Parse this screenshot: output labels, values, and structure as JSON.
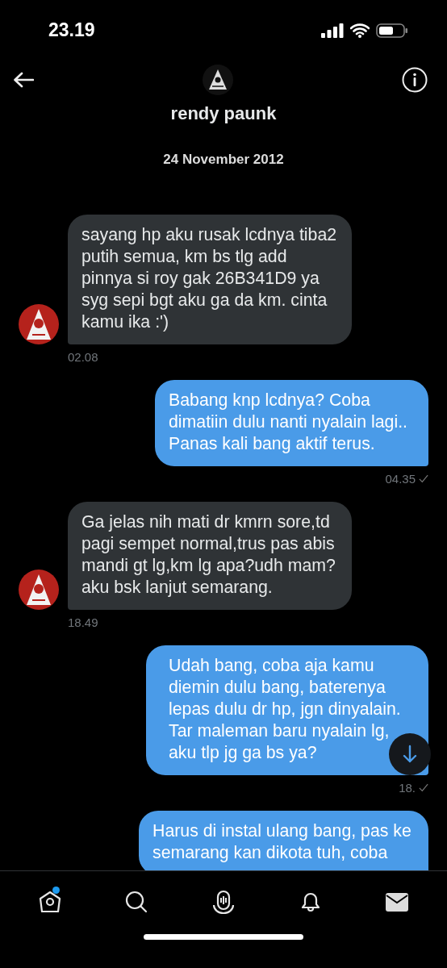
{
  "status_bar": {
    "time": "23.19"
  },
  "header": {
    "name": "rendy paunk",
    "date": "24 November 2012"
  },
  "messages": [
    {
      "kind": "received",
      "text": "sayang hp aku rusak lcdnya tiba2 putih semua, km bs tlg add pinnya si roy gak 26B341D9 ya syg sepi bgt aku ga da km. cinta kamu ika  :')",
      "time": "02.08"
    },
    {
      "kind": "sent",
      "text": "Babang knp lcdnya? Coba dimatiin dulu nanti nyalain lagi.. Panas kali bang aktif terus.",
      "time": "04.35",
      "checked": true
    },
    {
      "kind": "received",
      "text": "Ga jelas nih mati dr kmrn sore,td pagi sempet normal,trus pas abis mandi gt lg,km lg apa?udh mam? aku bsk lanjut semarang.",
      "time": "18.49"
    },
    {
      "kind": "sent",
      "text": "Udah bang, coba aja kamu diemin dulu bang, baterenya lepas dulu dr hp, jgn dinyalain. Tar maleman baru nyalain lg, aku tlp jg ga bs ya?",
      "time": "18.",
      "checked": true
    },
    {
      "kind": "sent",
      "text": "Harus di instal ulang bang, pas ke semarang kan dikota tuh, coba"
    }
  ],
  "nav": [
    {
      "kind": "home",
      "selected": false,
      "badge": true
    },
    {
      "kind": "search",
      "selected": false,
      "badge": false
    },
    {
      "kind": "spaces",
      "selected": false,
      "badge": false
    },
    {
      "kind": "notifications",
      "selected": false,
      "badge": false
    },
    {
      "kind": "messages",
      "selected": true,
      "badge": false
    }
  ]
}
